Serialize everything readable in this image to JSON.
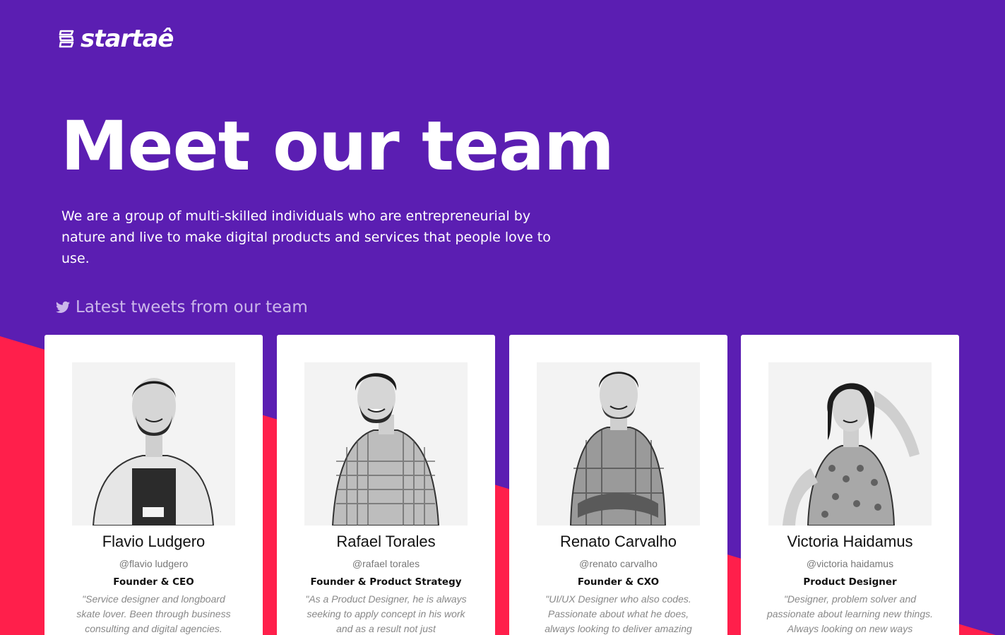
{
  "brand": {
    "logo_text": "startaê",
    "purple": "#5b1eb2",
    "accent_red": "#ff1f4b"
  },
  "hero": {
    "title": "Meet our team",
    "subtitle": "We are a group of multi-skilled individuals who are entrepreneurial by nature and live to make digital products and services that people love to use."
  },
  "tweets": {
    "heading": "Latest tweets from our team",
    "icon": "twitter-icon"
  },
  "team": [
    {
      "name": "Flavio Ludgero",
      "handle": "@flavio ludgero",
      "role": "Founder & CEO",
      "bio": "\"Service designer and longboard skate lover. Been through business consulting and digital agencies."
    },
    {
      "name": "Rafael Torales",
      "handle": "@rafael torales",
      "role": "Founder & Product Strategy",
      "bio": "\"As a Product Designer, he is always seeking to apply concept in his work and as a result not just"
    },
    {
      "name": "Renato Carvalho",
      "handle": "@renato carvalho",
      "role": "Founder & CXO",
      "bio": "\"UI/UX Designer who also codes. Passionate about what he does, always looking to deliver amazing"
    },
    {
      "name": "Victoria Haidamus",
      "handle": "@victoria haidamus",
      "role": "Product Designer",
      "bio": "\"Designer, problem solver and passionate about learning new things. Always looking on new ways"
    }
  ]
}
